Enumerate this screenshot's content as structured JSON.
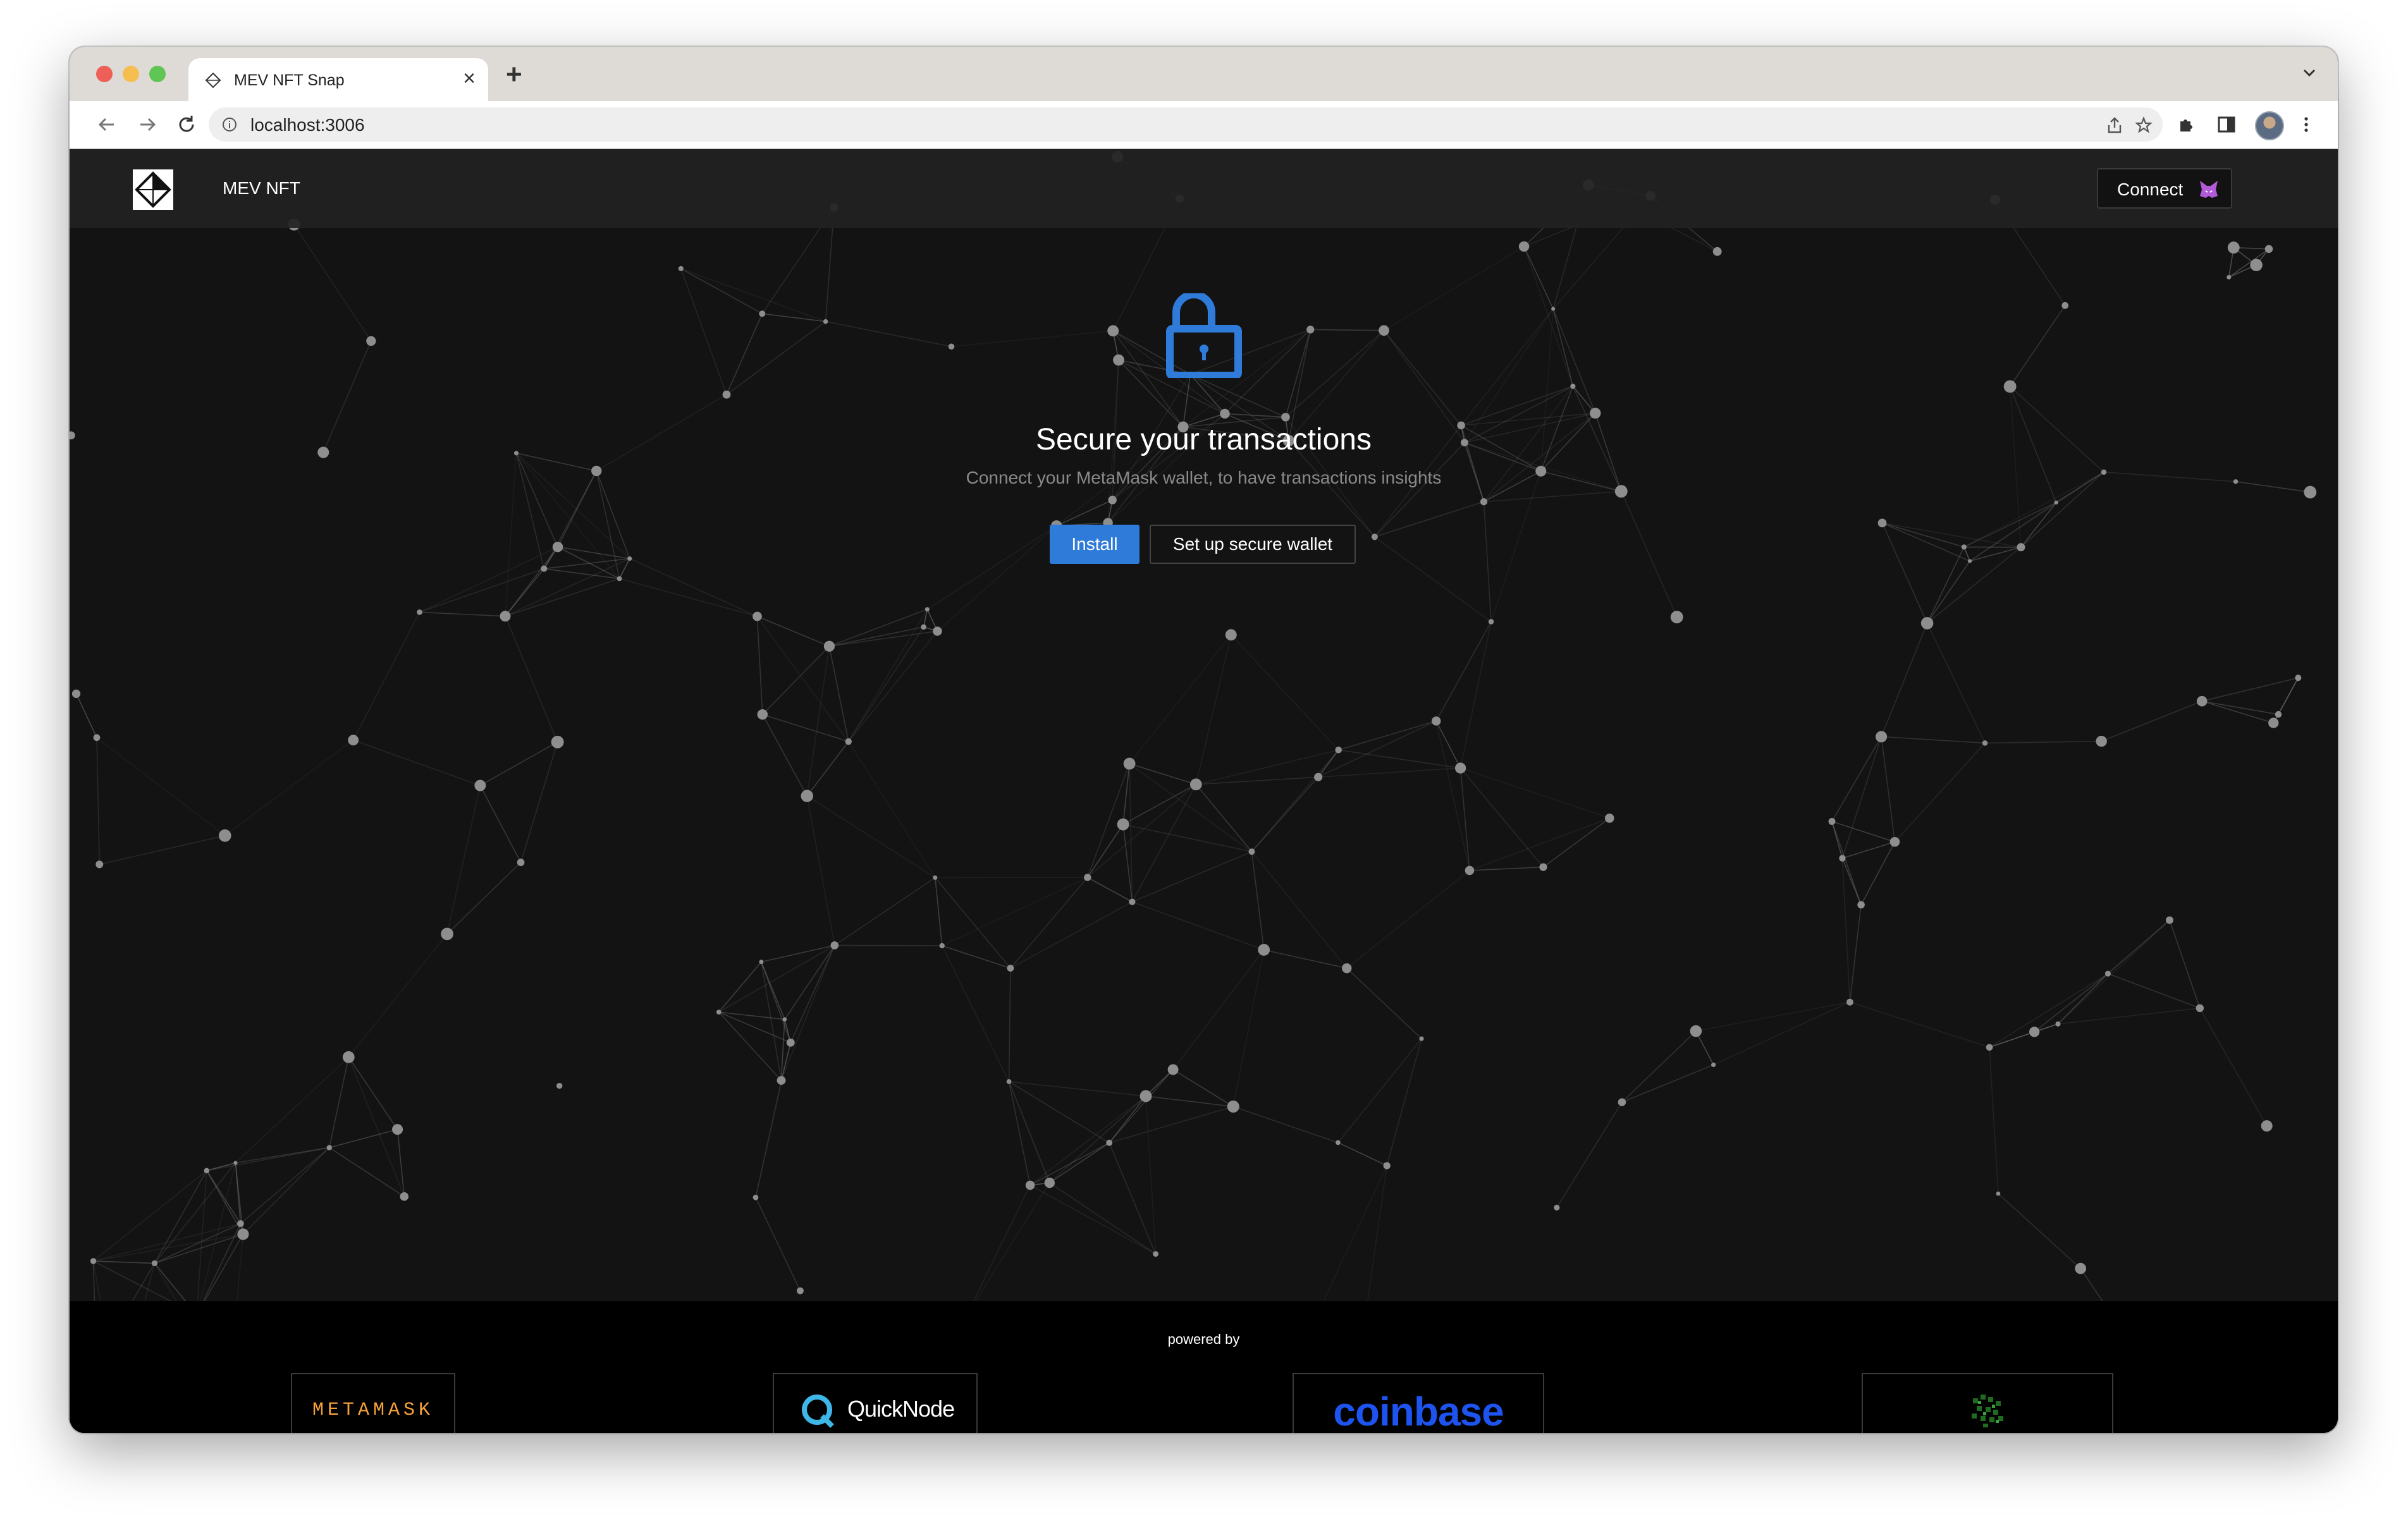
{
  "browser": {
    "tab_title": "MEV NFT Snap",
    "tab_close": "×",
    "new_tab": "+",
    "url": "localhost:3006"
  },
  "app": {
    "brand": "MEV NFT",
    "connect_label": "Connect",
    "hero": {
      "title": "Secure your transactions",
      "subtitle": "Connect your MetaMask wallet, to have transactions insights",
      "install_label": "Install",
      "setup_label": "Set up secure wallet"
    },
    "footer": {
      "powered_by": "powered by",
      "partners": {
        "metamask": "METAMASK",
        "quicknode": "QuickNode",
        "coinbase": "coinbase"
      }
    }
  },
  "colors": {
    "accent": "#2f7bd9",
    "lock": "#2f7bd9",
    "metamask": "#f6a23a",
    "coinbase": "#1d54f0",
    "page_bg": "#131313"
  }
}
